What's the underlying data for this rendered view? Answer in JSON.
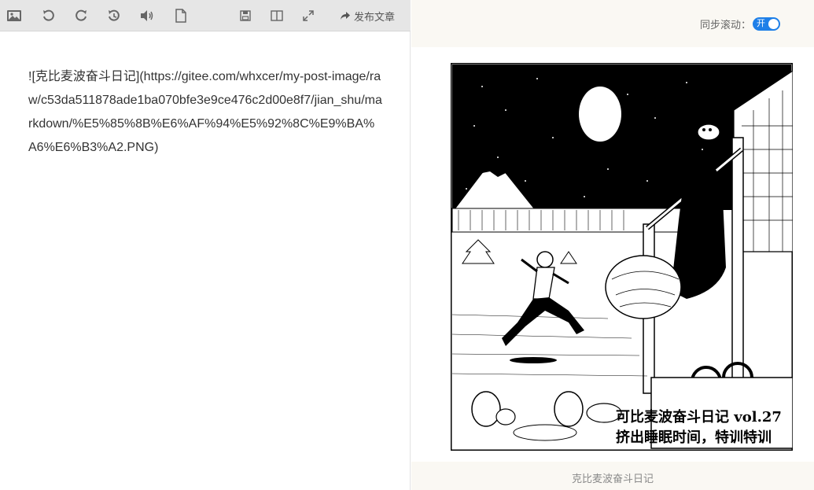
{
  "toolbar": {
    "icons": [
      "image-icon",
      "undo-icon",
      "redo-icon",
      "history-icon",
      "speaker-icon",
      "file-icon",
      "save-icon",
      "split-view-icon",
      "fullscreen-icon"
    ],
    "publish_label": "发布文章"
  },
  "editor": {
    "content": "![克比麦波奋斗日记](https://gitee.com/whxcer/my-post-image/raw/c53da511878ade1ba070bfe3e9ce476c2d00e8f7/jian_shu/markdown/%E5%85%8B%E6%AF%94%E5%92%8C%E9%BA%A6%E6%B3%A2.PNG)"
  },
  "preview": {
    "sync_label": "同步滚动：",
    "sync_toggle_label": "开",
    "image_alt": "克比麦波奋斗日记",
    "image_caption": "克比麦波奋斗日记",
    "manga_title_line1": "可比麦波奋斗日记 vol.27",
    "manga_title_line2": "挤出睡眠时间，特训特训"
  },
  "colors": {
    "toolbar_bg": "#e6e6e6",
    "toggle_on": "#1e7fe8",
    "preview_bg": "#faf8f3"
  }
}
